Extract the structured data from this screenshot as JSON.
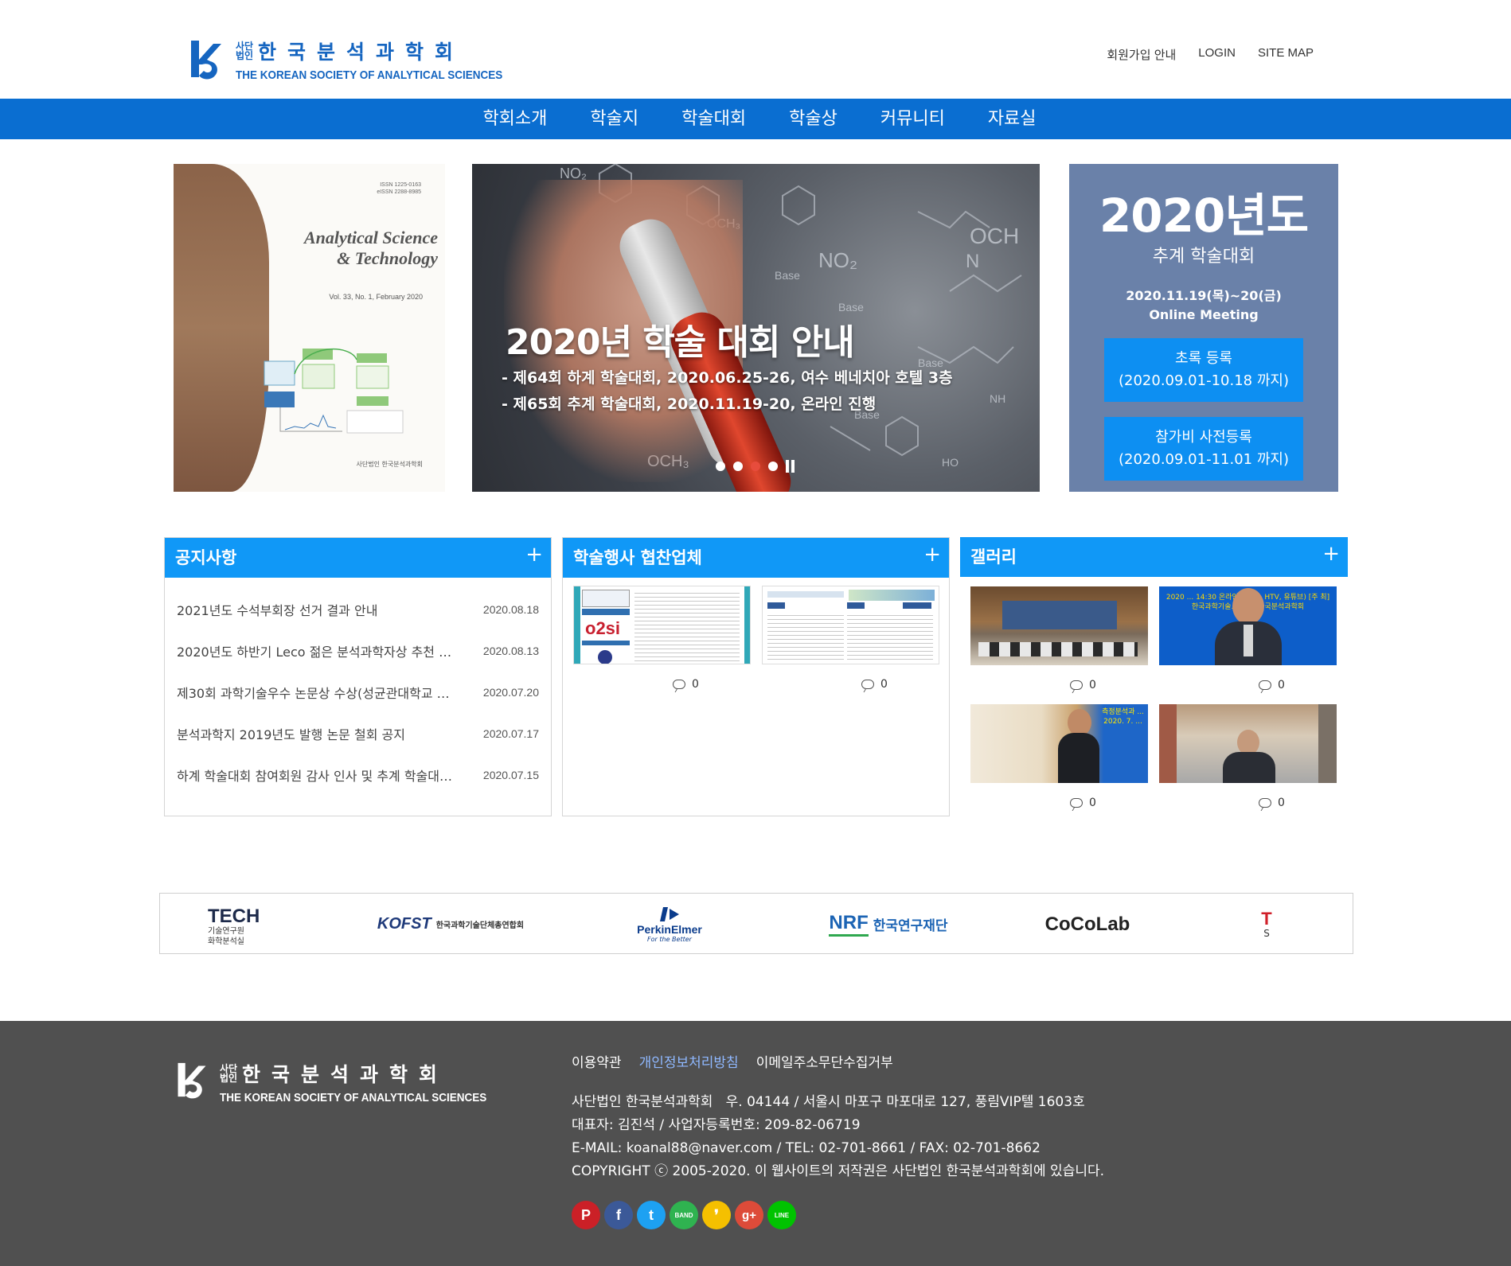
{
  "header": {
    "logo": {
      "small_top": "사단",
      "small_bottom": "법인",
      "korean": "한국분석과학회",
      "english": "THE KOREAN SOCIETY OF ANALYTICAL SCIENCES"
    },
    "util_links": [
      "회원가입 안내",
      "LOGIN",
      "SITE MAP"
    ]
  },
  "nav": {
    "items": [
      "학회소개",
      "학술지",
      "학술대회",
      "학술상",
      "커뮤니티",
      "자료실"
    ]
  },
  "journal_cover": {
    "issn": "ISSN 1225-0163\neISSN 2288-8985",
    "title_line1": "Analytical Science",
    "title_line2": "& Technology",
    "volume": "Vol. 33, No. 1, February 2020",
    "publisher": "사단법인 한국분석과학회"
  },
  "slider": {
    "title": "2020년 학술 대회 안내",
    "line1": "- 제64회 하계 학술대회, 2020.06.25-26,  여수 베네치아 호텔 3층",
    "line2": "- 제65회 추계 학술대회, 2020.11.19-20,    온라인 진행",
    "dots_count": 4,
    "active_dot": 3
  },
  "event": {
    "year": "2020년도",
    "name": "추계 학술대회",
    "date": "2020.11.19(목)~20(금)",
    "venue": "Online Meeting",
    "btn1_line1": "초록 등록",
    "btn1_line2": "(2020.09.01-10.18 까지)",
    "btn2_line1": "참가비 사전등록",
    "btn2_line2": "(2020.09.01-11.01 까지)",
    "bg_color": "#6a81a9",
    "btn_color": "#0d8ff2"
  },
  "notice": {
    "title": "공지사항",
    "plus": "+",
    "items": [
      {
        "title": "2021년도 수석부회장 선거 결과 안내",
        "date": "2020.08.18"
      },
      {
        "title": "2020년도 하반기 Leco 젊은 분석과학자상 추천 …",
        "date": "2020.08.13"
      },
      {
        "title": "제30회 과학기술우수 논문상 수상(성균관대학교 …",
        "date": "2020.07.20"
      },
      {
        "title": "분석과학지 2019년도 발행 논문 철회 공지",
        "date": "2020.07.17"
      },
      {
        "title": "하계 학술대회 참여회원 감사 인사 및 추계 학술대…",
        "date": "2020.07.15"
      }
    ]
  },
  "sponsor": {
    "title": "학술행사 협찬업체",
    "plus": "+",
    "items": [
      {
        "comments": "0"
      },
      {
        "comments": "0"
      }
    ]
  },
  "gallery": {
    "title": "갤러리",
    "plus": "+",
    "items": [
      {
        "comments": "0"
      },
      {
        "comments": "0",
        "caption": "2020 ... 14:30 온라인 성 (Y... HTV, 유튜브) [주 최] 한국과학기술... 학회, 한국분석과학회"
      },
      {
        "comments": "0",
        "caption": "측정분석과 ... 2020. 7. ..."
      },
      {
        "comments": "0"
      }
    ]
  },
  "banners": [
    {
      "name": "TECH 화학분석실",
      "text_main": "TECH",
      "text_sub1": "기술연구원",
      "text_sub2": "화학분석실"
    },
    {
      "name": "KOFST",
      "text_main": "KOFST",
      "text_sub": "한국과학기술단체총연합회"
    },
    {
      "name": "PerkinElmer",
      "text_main": "PerkinElmer",
      "text_sub": "For the Better"
    },
    {
      "name": "NRF",
      "text_main": "NRF",
      "text_sub": "한국연구재단"
    },
    {
      "name": "CoCoLab",
      "text_main": "CoCoLab"
    },
    {
      "name": "T S",
      "text_main": "T",
      "text_sub": "S"
    }
  ],
  "footer": {
    "links": [
      "이용약관",
      "개인정보처리방침",
      "이메일주소무단수집거부"
    ],
    "info_line1": "사단법인 한국분석과학회   우. 04144 / 서울시 마포구 마포대로 127, 풍림VIP텔 1603호",
    "info_line2": "대표자: 김진석 / 사업자등록번호: 209-82-06719",
    "info_line3": "E-MAIL: koanal88@naver.com / TEL: 02-701-8661 / FAX: 02-701-8662",
    "info_line4": "COPYRIGHT ⓒ 2005-2020. 이 웹사이트의 저작권은 사단법인 한국분석과학회에 있습니다.",
    "sns": [
      {
        "name": "pinterest",
        "label": "P",
        "color": "#cb2027"
      },
      {
        "name": "facebook",
        "label": "f",
        "color": "#3b5998"
      },
      {
        "name": "twitter",
        "label": "t",
        "color": "#1da1f2"
      },
      {
        "name": "band",
        "label": "BAND",
        "color": "#2fb350"
      },
      {
        "name": "kakaostory",
        "label": "❜",
        "color": "#f5c000"
      },
      {
        "name": "googleplus",
        "label": "g+",
        "color": "#dd4b39"
      },
      {
        "name": "line",
        "label": "LINE",
        "color": "#00c300"
      }
    ]
  }
}
